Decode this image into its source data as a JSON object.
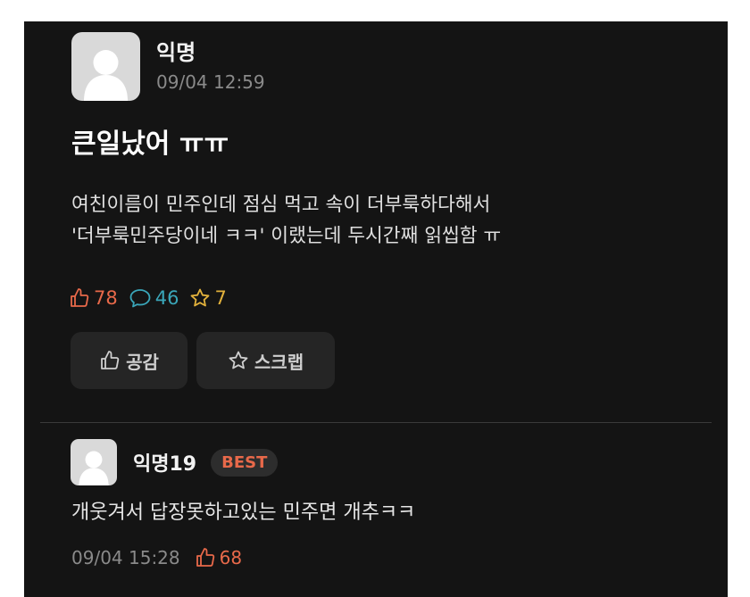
{
  "post": {
    "author": "익명",
    "time": "09/04 12:59",
    "title": "큰일났어 ㅠㅠ",
    "body_line1": "여친이름이 민주인데 점심 먹고 속이 더부룩하다해서",
    "body_line2": "'더부룩민주당이네 ㅋㅋ' 이랬는데 두시간째 읽씹함 ㅠ",
    "likes": "78",
    "comments": "46",
    "scraps": "7",
    "like_button": "공감",
    "scrap_button": "스크랩",
    "avatar_icon": "anonymous-avatar-icon"
  },
  "comment": {
    "author": "익명19",
    "badge": "BEST",
    "text": "개웃겨서 답장못하고있는 민주면 개추ㅋㅋ",
    "time": "09/04 15:28",
    "likes": "68"
  },
  "colors": {
    "background": "#141414",
    "like": "#e8694a",
    "comment": "#3aa6b9",
    "scrap": "#e3b23c"
  }
}
